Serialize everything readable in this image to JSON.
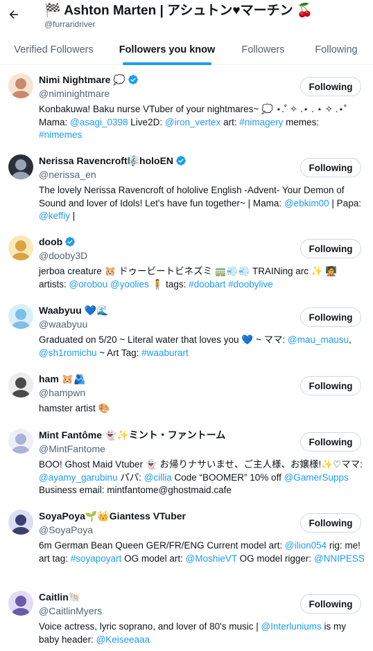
{
  "header": {
    "title": "🏁 Ashton Marten | アシュトン♥マーチン 🍒",
    "handle": "@furraridriver"
  },
  "tabs": [
    {
      "label": "Verified Followers",
      "active": false
    },
    {
      "label": "Followers you know",
      "active": true
    },
    {
      "label": "Followers",
      "active": false
    },
    {
      "label": "Following",
      "active": false
    }
  ],
  "follow_label": "Following",
  "colors": {
    "accent": "#1d9bf0",
    "verified": "#1d9bf0",
    "text": "#0f1419",
    "secondary": "#536471"
  },
  "users": [
    {
      "name": "Nimi Nightmare 💭",
      "verified": true,
      "handle": "@niminightmare",
      "bio": [
        {
          "t": "Konbakuwa! Baku nurse VTuber of your nightmares~ 💭 ⋆.˚ ✧ .⋆ . ⋆ ✧ .⋆˚ Mama: "
        },
        {
          "t": "@asagi_0398",
          "link": true
        },
        {
          "t": " Live2D: "
        },
        {
          "t": "@iron_vertex",
          "link": true
        },
        {
          "t": " art: "
        },
        {
          "t": "#nimagery",
          "link": true
        },
        {
          "t": " memes: "
        },
        {
          "t": "#nimemes",
          "link": true
        }
      ]
    },
    {
      "name": "Nerissa Ravencroft🎼holoEN",
      "verified": true,
      "handle": "@nerissa_en",
      "bio": [
        {
          "t": "The lovely Nerissa Ravencroft of hololive English -Advent- Your Demon of Sound and lover of Idols! Let's have fun together~ | Mama: "
        },
        {
          "t": "@ebkim00",
          "link": true
        },
        {
          "t": " | Papa: "
        },
        {
          "t": "@keffiy",
          "link": true
        },
        {
          "t": " |"
        }
      ]
    },
    {
      "name": "doob",
      "verified": true,
      "handle": "@dooby3D",
      "bio": [
        {
          "t": "jerboa creature 🐹 ドゥービートビネズミ 🚃💨💨 TRAINing arc ✨ 🧑‍🏫 artists: "
        },
        {
          "t": "@orobou",
          "link": true
        },
        {
          "t": " "
        },
        {
          "t": "@yoolies",
          "link": true
        },
        {
          "t": " 🧍 tags: "
        },
        {
          "t": "#doobart",
          "link": true
        },
        {
          "t": " "
        },
        {
          "t": "#doobylive",
          "link": true
        }
      ]
    },
    {
      "name": "Waabyuu 💙🌊",
      "verified": false,
      "handle": "@waabyuu",
      "bio": [
        {
          "t": "Graduated on 5/20 ~ Literal water that loves you 💙 ~ ママ: "
        },
        {
          "t": "@mau_mausu",
          "link": true
        },
        {
          "t": ", "
        },
        {
          "t": "@sh1romichu",
          "link": true
        },
        {
          "t": " ~ Art Tag: "
        },
        {
          "t": "#waaburart",
          "link": true
        }
      ]
    },
    {
      "name": "ham 🐹🫂",
      "verified": false,
      "handle": "@hampwn",
      "bio": [
        {
          "t": "hamster artist 🎨"
        }
      ]
    },
    {
      "name": "Mint Fantôme 👻✨ミント・ファントーム",
      "verified": false,
      "handle": "@MintFantome",
      "bio": [
        {
          "t": "BOO! Ghost Maid Vtuber 👻 お帰りナサいませ、ご主人様、お嬢様!✨♡ママ: "
        },
        {
          "t": "@ayamy_garubinu",
          "link": true
        },
        {
          "t": " パパ: "
        },
        {
          "t": "@cillia",
          "link": true
        },
        {
          "t": " Code “BOOMER” 10% off "
        },
        {
          "t": "@GamerSupps",
          "link": true
        },
        {
          "t": " Business email: mintfantome@ghostmaid.cafe"
        }
      ]
    },
    {
      "name": "SoyaPoya🌱👑Giantess VTuber",
      "verified": false,
      "handle": "@SoyaPoya",
      "bio": [
        {
          "t": "6m German Bean Queen GER/FR/ENG Current model art: "
        },
        {
          "t": "@ilion054",
          "link": true
        },
        {
          "t": " rig: me! art tag: "
        },
        {
          "t": "#soyapoyart",
          "link": true
        },
        {
          "t": " OG model art: "
        },
        {
          "t": "@MoshieVT",
          "link": true
        },
        {
          "t": " OG model rigger: "
        },
        {
          "t": "@NNIPESS",
          "link": true
        }
      ]
    },
    {
      "name": "Caitlin🐚",
      "verified": false,
      "handle": "@CaitlinMyers",
      "bio": [
        {
          "t": "Voice actress, lyric soprano, and lover of 80's music | "
        },
        {
          "t": "@Interluniums",
          "link": true
        },
        {
          "t": " is my baby header: "
        },
        {
          "t": "@Keiseeaaa",
          "link": true
        }
      ]
    }
  ]
}
